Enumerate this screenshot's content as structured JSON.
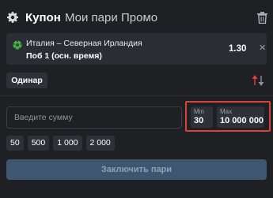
{
  "header": {
    "tabs": [
      {
        "label": "Купон",
        "active": true
      },
      {
        "label": "Мои пари",
        "active": false
      },
      {
        "label": "Промо",
        "active": false
      }
    ],
    "settings_icon": "gear-icon",
    "delete_icon": "trash-icon"
  },
  "bet": {
    "sport_icon": "football-icon",
    "match": "Италия – Северная Ирландия",
    "outcome": "Поб 1 (осн. время)",
    "odds": "1.30",
    "remove_icon": "close-icon"
  },
  "bet_type": {
    "label": "Одинар"
  },
  "amount": {
    "placeholder": "Введите сумму",
    "value": ""
  },
  "limits": {
    "min_label": "Min",
    "min_value": "30",
    "max_label": "Max",
    "max_value": "10 000 000"
  },
  "quick_amounts": [
    "50",
    "500",
    "1 000",
    "2 000"
  ],
  "submit": {
    "label": "Заключить пари"
  },
  "colors": {
    "background": "#1e2024",
    "card": "#2a2d33",
    "button": "#3e5670",
    "highlight": "#d9433a"
  }
}
